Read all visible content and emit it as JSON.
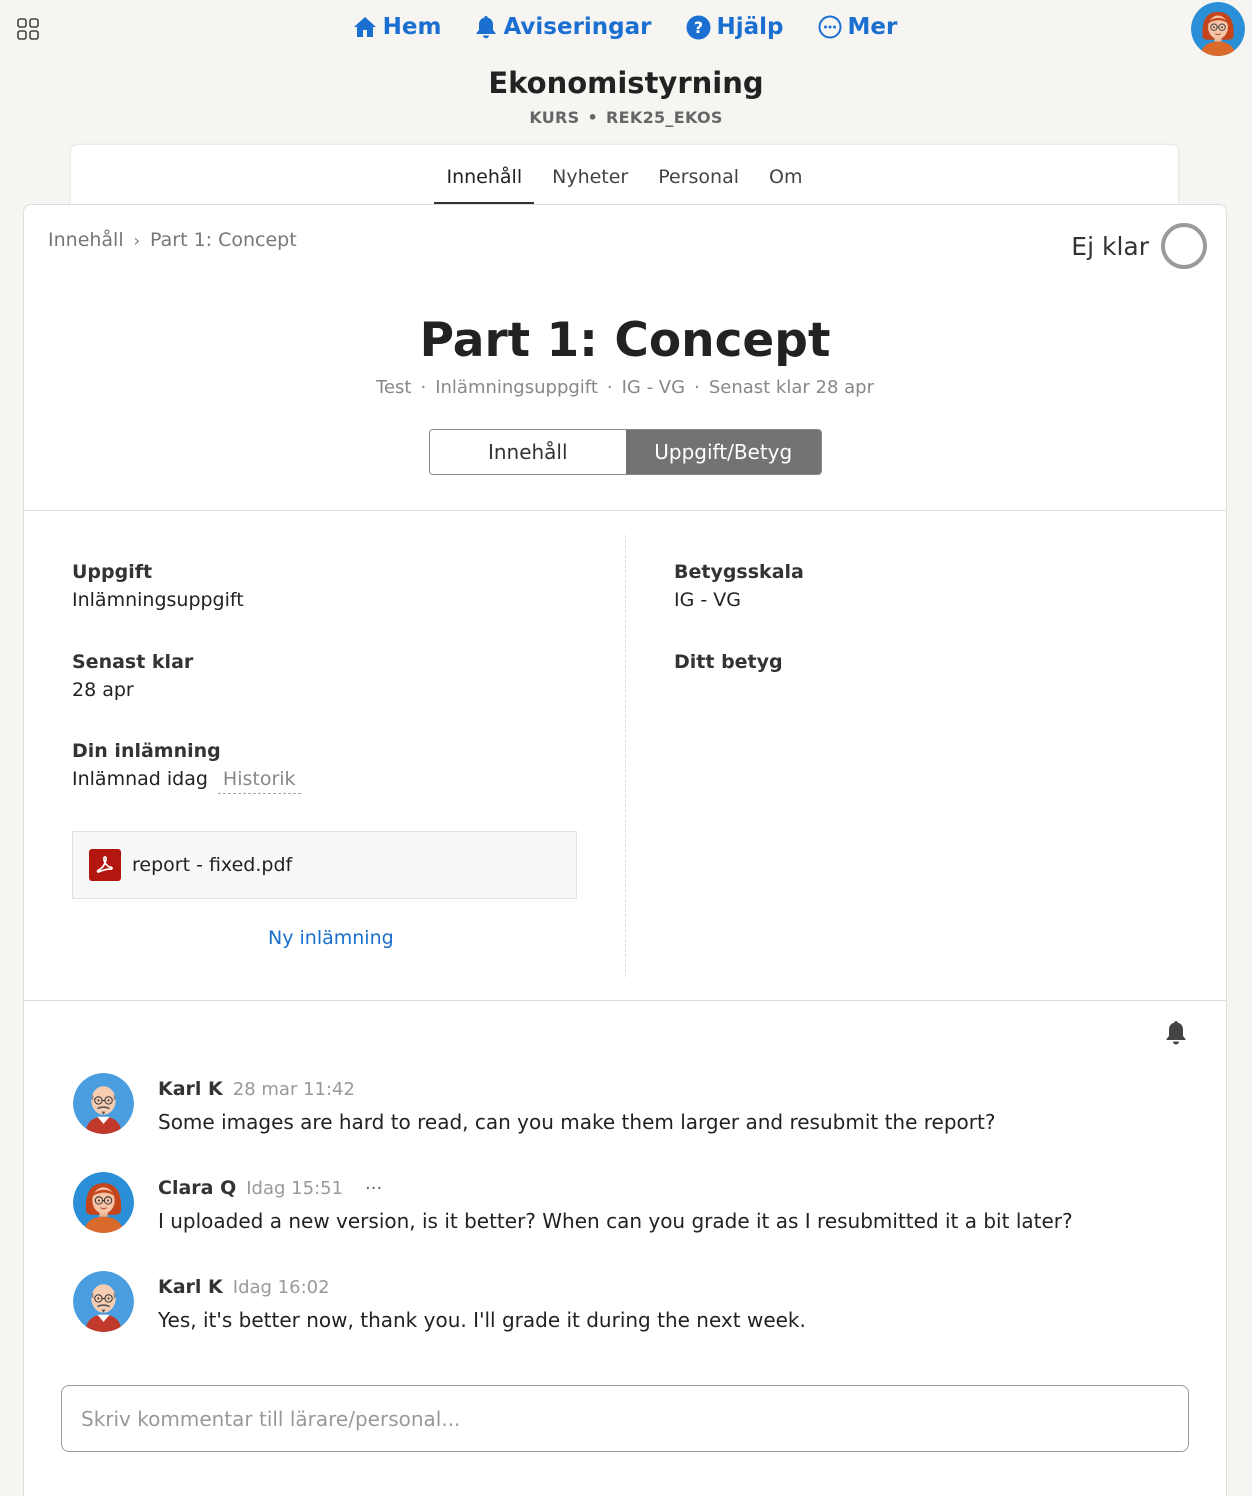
{
  "topnav": {
    "apps_icon": "grid-icon",
    "links": [
      {
        "label": "Hem",
        "icon": "home-icon"
      },
      {
        "label": "Aviseringar",
        "icon": "bell-icon"
      },
      {
        "label": "Hjälp",
        "icon": "help-circle-icon"
      },
      {
        "label": "Mer",
        "icon": "more-circle-icon"
      }
    ],
    "accent": "#1a6fd0"
  },
  "course": {
    "title": "Ekonomistyrning",
    "type": "KURS",
    "code": "REK25_EKOS"
  },
  "tabs": [
    {
      "label": "Innehåll",
      "active": true
    },
    {
      "label": "Nyheter",
      "active": false
    },
    {
      "label": "Personal",
      "active": false
    },
    {
      "label": "Om",
      "active": false
    }
  ],
  "breadcrumb": {
    "root": "Innehåll",
    "sep": "›",
    "current": "Part 1: Concept"
  },
  "status": {
    "label": "Ej klar"
  },
  "page": {
    "title": "Part 1: Concept",
    "meta": [
      "Test",
      "Inlämningsuppgift",
      "IG - VG",
      "Senast klar 28 apr"
    ]
  },
  "view_toggle": {
    "content": "Innehåll",
    "grade": "Uppgift/Betyg",
    "active": "grade"
  },
  "details": {
    "assignment_label": "Uppgift",
    "assignment_value": "Inlämningsuppgift",
    "deadline_label": "Senast klar",
    "deadline_value": "28 apr",
    "submission_label": "Din inlämning",
    "submission_value": "Inlämnad idag",
    "history_link": "Historik",
    "file_name": "report - fixed.pdf",
    "new_submission": "Ny inlämning",
    "scale_label": "Betygsskala",
    "scale_value": "IG - VG",
    "grade_label": "Ditt betyg"
  },
  "comments": [
    {
      "author": "Karl K",
      "time": "28 mar 11:42",
      "text": "Some images are hard to read, can you make them larger and resubmit the report?",
      "more": ""
    },
    {
      "author": "Clara Q",
      "time": "Idag 15:51",
      "text": "I uploaded a new version, is it better? When can you grade it as I resubmitted it a bit later?",
      "more": "···"
    },
    {
      "author": "Karl K",
      "time": "Idag 16:02",
      "text": "Yes, it's better now, thank you. I'll grade it during the next week.",
      "more": ""
    }
  ],
  "comment_input": {
    "placeholder": "Skriv kommentar till lärare/personal..."
  }
}
